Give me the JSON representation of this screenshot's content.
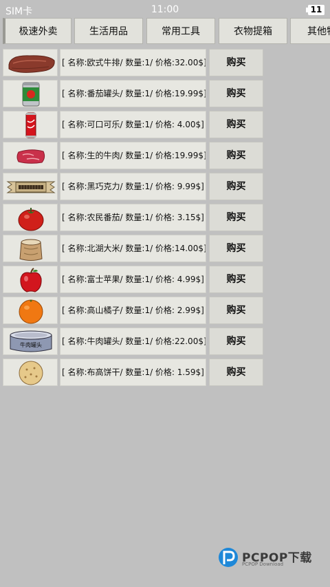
{
  "status_bar": {
    "carrier": "SIM卡",
    "time": "11:00",
    "battery": "11"
  },
  "tabs": [
    {
      "label": "极速外卖"
    },
    {
      "label": "生活用品"
    },
    {
      "label": "常用工具"
    },
    {
      "label": "衣物提箱"
    },
    {
      "label": "其他物"
    }
  ],
  "products": [
    {
      "info": "[ 名称:欧式牛排/ 数量:1/ 价格:32.00$]",
      "buy": "购买",
      "icon": "steak-icon"
    },
    {
      "info": "[ 名称:番茄罐头/ 数量:1/ 价格:19.99$]",
      "buy": "购买",
      "icon": "tomato-can-icon"
    },
    {
      "info": "[ 名称:可口可乐/ 数量:1/ 价格:  4.00$]",
      "buy": "购买",
      "icon": "cola-can-icon"
    },
    {
      "info": "[ 名称:生的牛肉/ 数量:1/ 价格:19.99$]",
      "buy": "购买",
      "icon": "raw-beef-icon"
    },
    {
      "info": "[ 名称:黑巧克力/ 数量:1/ 价格:  9.99$]",
      "buy": "购买",
      "icon": "chocolate-bar-icon"
    },
    {
      "info": "[ 名称:农民番茄/ 数量:1/ 价格:  3.15$]",
      "buy": "购买",
      "icon": "tomato-icon"
    },
    {
      "info": "[ 名称:北湖大米/ 数量:1/ 价格:14.00$]",
      "buy": "购买",
      "icon": "rice-sack-icon"
    },
    {
      "info": "[ 名称:富士苹果/ 数量:1/ 价格:  4.99$]",
      "buy": "购买",
      "icon": "apple-icon"
    },
    {
      "info": "[ 名称:高山橘子/ 数量:1/ 价格:  2.99$]",
      "buy": "购买",
      "icon": "orange-icon"
    },
    {
      "info": "[ 名称:牛肉罐头/ 数量:1/ 价格:22.00$]",
      "buy": "购买",
      "icon": "beef-can-icon",
      "icon_label": "牛肉罐头"
    },
    {
      "info": "[ 名称:布高饼干/ 数量:1/ 价格:  1.59$]",
      "buy": "购买",
      "icon": "biscuit-icon"
    }
  ],
  "watermark": {
    "brand": "PCPOP下载",
    "sub": "PCPOP Download"
  },
  "colors": {
    "background": "#c0c0c0",
    "cell": "#e7e7e1",
    "tab": "#e2e2dc"
  }
}
